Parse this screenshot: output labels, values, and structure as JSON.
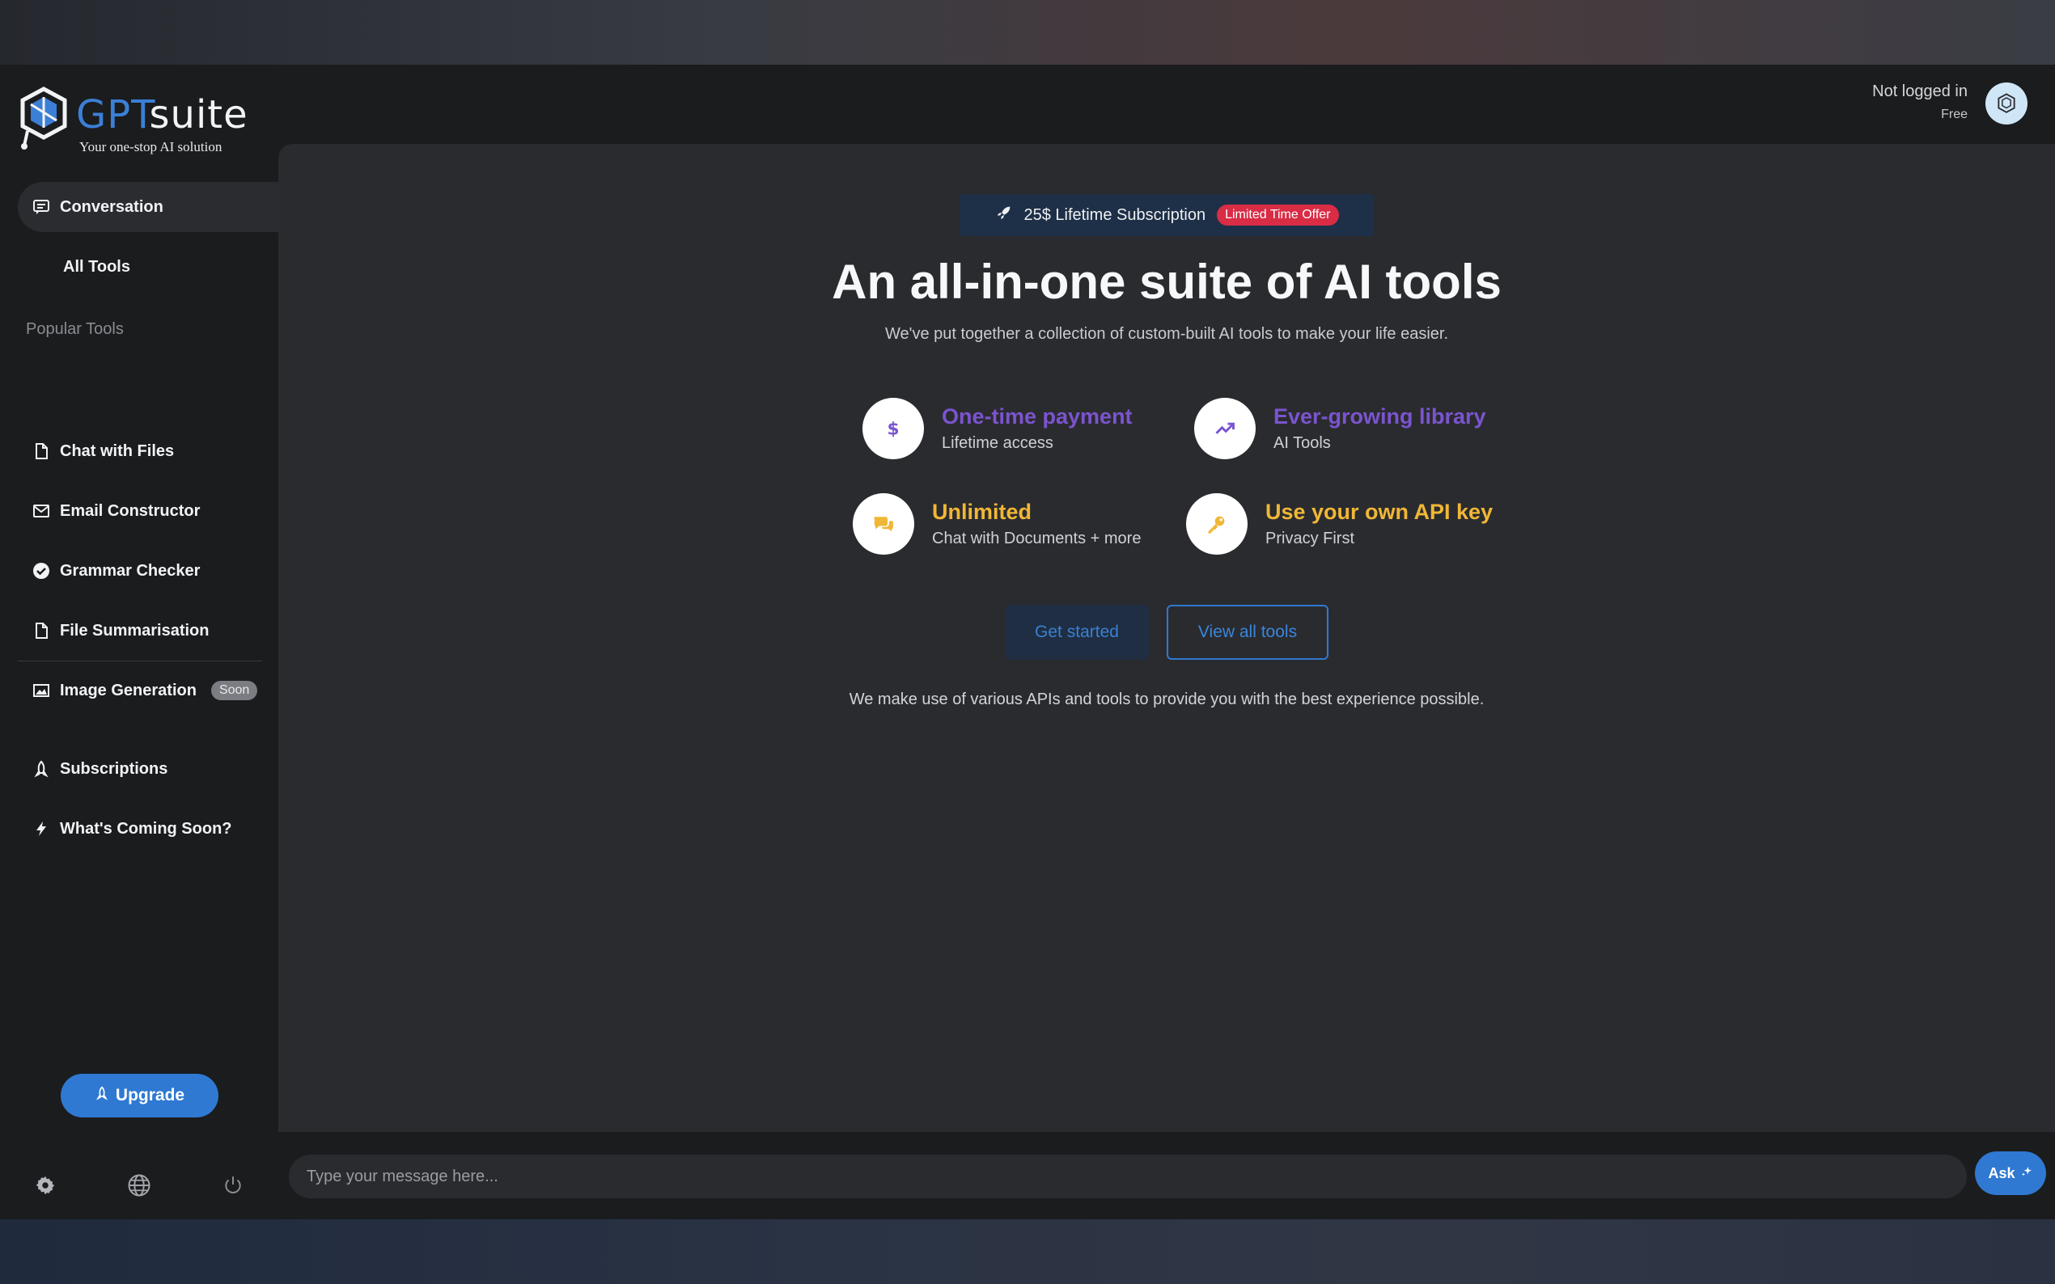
{
  "brand": {
    "name_part1": "GPT",
    "name_part2": "suite",
    "tagline": "Your one-stop AI solution"
  },
  "sidebar": {
    "nav": [
      {
        "label": "Conversation",
        "icon": "chat-icon"
      },
      {
        "label": "All Tools",
        "icon": ""
      }
    ],
    "section_label": "Popular Tools",
    "tools": [
      {
        "label": "Chat with Files",
        "icon": "file-icon"
      },
      {
        "label": "Email Constructor",
        "icon": "mail-icon"
      },
      {
        "label": "Grammar Checker",
        "icon": "check-circle-icon"
      },
      {
        "label": "File Summarisation",
        "icon": "file-icon"
      },
      {
        "label": "Image Generation",
        "icon": "image-icon",
        "badge": "Soon"
      }
    ],
    "extra": [
      {
        "label": "Subscriptions",
        "icon": "rocket-icon"
      },
      {
        "label": "What's Coming Soon?",
        "icon": "bolt-icon"
      }
    ],
    "upgrade_label": "Upgrade"
  },
  "header": {
    "user_status": "Not logged in",
    "plan": "Free"
  },
  "main": {
    "promo_text": "25$ Lifetime Subscription",
    "promo_badge": "Limited Time Offer",
    "title": "An all-in-one suite of AI tools",
    "subtitle": "We've put together a collection of custom-built AI tools to make your life easier.",
    "features": [
      {
        "title": "One-time payment",
        "sub": "Lifetime access",
        "icon": "dollar-icon",
        "color": "#7b54cf"
      },
      {
        "title": "Ever-growing library",
        "sub": "AI Tools",
        "icon": "trending-up-icon",
        "color": "#7b54cf"
      },
      {
        "title": "Unlimited",
        "sub": "Chat with Documents + more",
        "icon": "chat-bubbles-icon",
        "color": "#f0b736"
      },
      {
        "title": "Use your own API key",
        "sub": "Privacy First",
        "icon": "key-icon",
        "color": "#f0b736"
      }
    ],
    "get_started_label": "Get started",
    "view_tools_label": "View all tools",
    "footnote": "We make use of various APIs and tools to provide you with the best experience possible."
  },
  "composer": {
    "placeholder": "Type your message here...",
    "ask_label": "Ask"
  },
  "colors": {
    "accent": "#2f79d2",
    "purple": "#7b54cf",
    "gold": "#f0b736",
    "danger": "#d92c45"
  }
}
